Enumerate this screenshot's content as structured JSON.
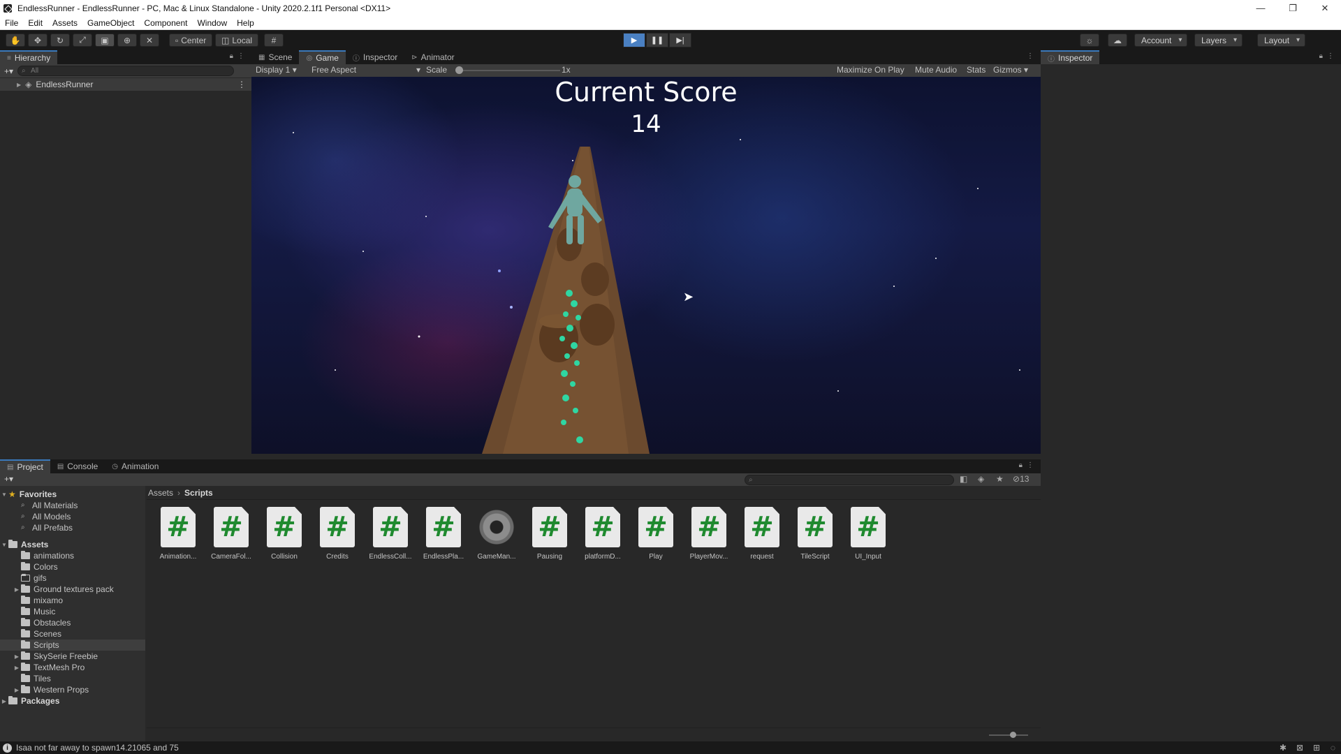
{
  "window": {
    "title": "EndlessRunner - EndlessRunner - PC, Mac & Linux Standalone - Unity 2020.2.1f1 Personal <DX11>"
  },
  "menu": [
    "File",
    "Edit",
    "Assets",
    "GameObject",
    "Component",
    "Window",
    "Help"
  ],
  "toolbar": {
    "pivot_label": "Center",
    "space_label": "Local",
    "account_label": "Account",
    "layers_label": "Layers",
    "layout_label": "Layout"
  },
  "hierarchy": {
    "tab_label": "Hierarchy",
    "search_placeholder": "All",
    "root_item": "EndlessRunner"
  },
  "center_tabs": [
    "Scene",
    "Game",
    "Inspector",
    "Animator"
  ],
  "game_toolbar": {
    "display": "Display 1",
    "aspect": "Free Aspect",
    "scale_label": "Scale",
    "scale_value": "1x",
    "maximize": "Maximize On Play",
    "mute": "Mute Audio",
    "stats": "Stats",
    "gizmos": "Gizmos"
  },
  "game": {
    "score_title": "Current Score",
    "score_value": "14"
  },
  "inspector": {
    "tab_label": "Inspector"
  },
  "bottom_tabs": [
    "Project",
    "Console",
    "Animation"
  ],
  "project": {
    "hidden_count": "13",
    "favorites_label": "Favorites",
    "favorites": [
      "All Materials",
      "All Models",
      "All Prefabs"
    ],
    "assets_label": "Assets",
    "folders": [
      "animations",
      "Colors",
      "gifs",
      "Ground textures pack",
      "mixamo",
      "Music",
      "Obstacles",
      "Scenes",
      "Scripts",
      "SkySerie Freebie",
      "TextMesh Pro",
      "Tiles",
      "Western Props"
    ],
    "packages_label": "Packages",
    "breadcrumb": [
      "Assets",
      "Scripts"
    ],
    "files": [
      {
        "name": "Animation...",
        "icon": "script-icon"
      },
      {
        "name": "CameraFol...",
        "icon": "script-icon"
      },
      {
        "name": "Collision",
        "icon": "script-icon"
      },
      {
        "name": "Credits",
        "icon": "script-icon"
      },
      {
        "name": "EndlessColl...",
        "icon": "script-icon"
      },
      {
        "name": "EndlessPla...",
        "icon": "script-icon"
      },
      {
        "name": "GameMan...",
        "icon": "gear-icon"
      },
      {
        "name": "Pausing",
        "icon": "script-icon"
      },
      {
        "name": "platformD...",
        "icon": "script-icon"
      },
      {
        "name": "Play",
        "icon": "script-icon"
      },
      {
        "name": "PlayerMov...",
        "icon": "script-icon"
      },
      {
        "name": "request",
        "icon": "script-icon"
      },
      {
        "name": "TileScript",
        "icon": "script-icon"
      },
      {
        "name": "UI_Input",
        "icon": "script-icon"
      }
    ]
  },
  "status": {
    "message": "Isaa not far away to spawn14.21065 and 75"
  },
  "colors": {
    "accent": "#3a79bb",
    "play_active": "#4a80c2",
    "script_hash": "#1f8a2f",
    "editor_bg": "#282828"
  }
}
